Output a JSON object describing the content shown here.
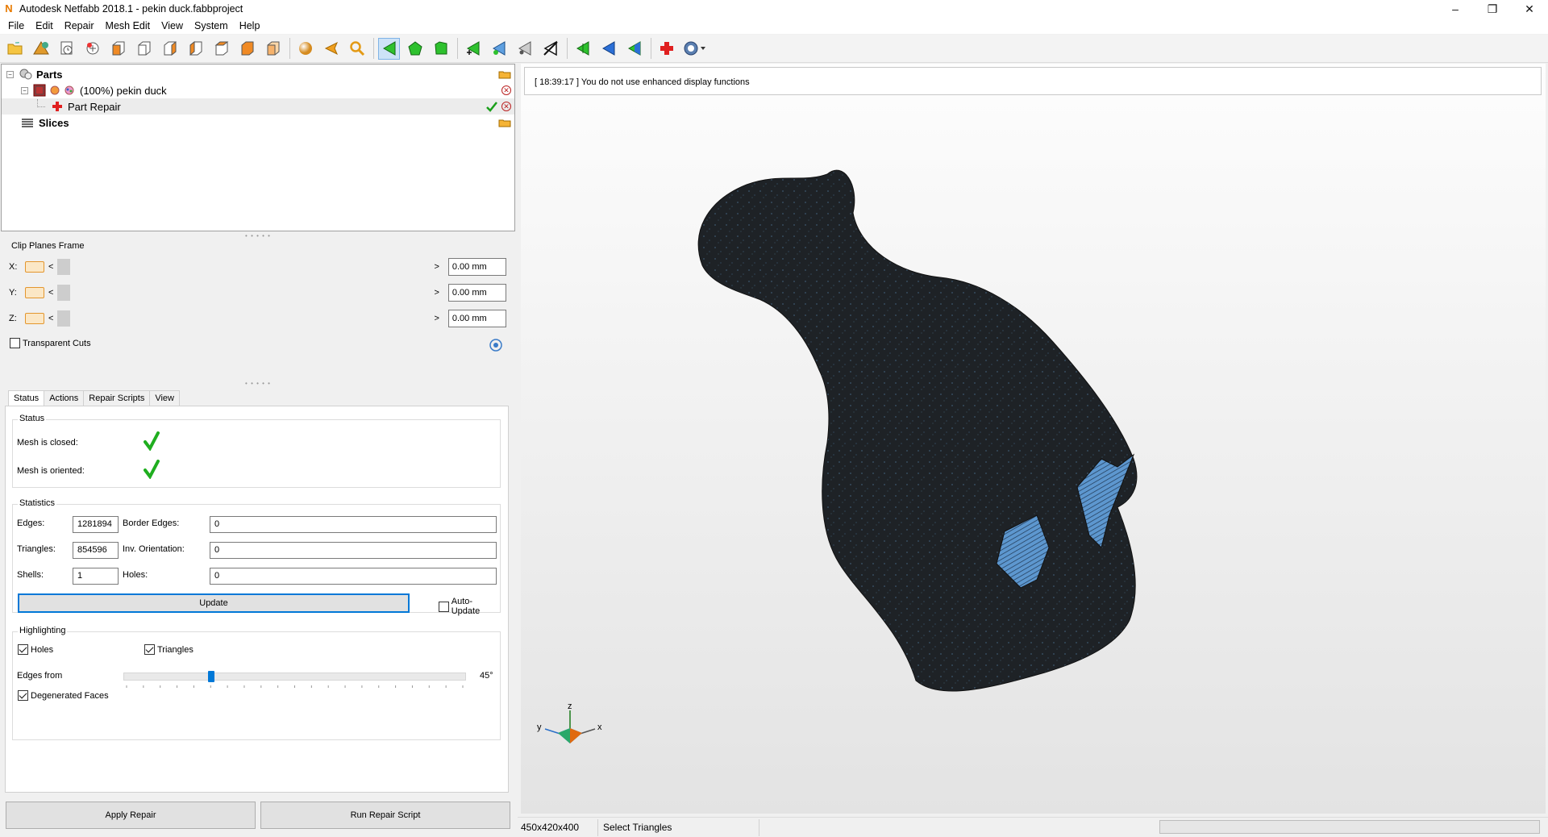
{
  "window": {
    "title": "Autodesk Netfabb 2018.1 - pekin duck.fabbproject",
    "app_icon": "N",
    "minimize": "–",
    "maximize": "❐",
    "close": "✕"
  },
  "menu": [
    "File",
    "Edit",
    "Repair",
    "Mesh Edit",
    "View",
    "System",
    "Help"
  ],
  "toolbar_icons": [
    "open-folder-icon",
    "add-part-icon",
    "save-icon",
    "new-project-icon",
    "view-front-icon",
    "view-back-icon",
    "view-left-icon",
    "view-right-icon",
    "view-top-icon",
    "view-bottom-icon",
    "view-iso-icon",
    "sphere-icon",
    "arrow-left-icon",
    "zoom-icon",
    "select-triangle-icon",
    "select-surface-icon",
    "select-shell-icon",
    "add-triangle-icon",
    "remove-triangle-icon",
    "move-point-icon",
    "cut-icon",
    "triangle-green-icon",
    "triangle-blue-icon",
    "triangle-mixed-icon",
    "repair-cross-icon",
    "help-dropdown-icon"
  ],
  "tree": {
    "parts_label": "Parts",
    "part_label": "(100%) pekin duck",
    "repair_label": "Part Repair",
    "slices_label": "Slices"
  },
  "clip": {
    "title": "Clip Planes Frame",
    "axes": [
      {
        "axis": "X:",
        "value": "0.00 mm"
      },
      {
        "axis": "Y:",
        "value": "0.00 mm"
      },
      {
        "axis": "Z:",
        "value": "0.00 mm"
      }
    ],
    "transparent_label": "Transparent Cuts",
    "left_arrow": "<",
    "right_arrow": ">"
  },
  "tabs": [
    "Status",
    "Actions",
    "Repair Scripts",
    "View"
  ],
  "status": {
    "group_title": "Status",
    "closed_label": "Mesh is closed:",
    "oriented_label": "Mesh is oriented:"
  },
  "stats": {
    "group_title": "Statistics",
    "edges_label": "Edges:",
    "edges_value": "1281894",
    "border_edges_label": "Border Edges:",
    "border_edges_value": "0",
    "triangles_label": "Triangles:",
    "triangles_value": "854596",
    "inv_orientation_label": "Inv. Orientation:",
    "inv_orientation_value": "0",
    "shells_label": "Shells:",
    "shells_value": "1",
    "holes_label": "Holes:",
    "holes_value": "0",
    "update_label": "Update",
    "auto_update_label": "Auto-Update"
  },
  "highlighting": {
    "group_title": "Highlighting",
    "holes_label": "Holes",
    "triangles_label": "Triangles",
    "edges_from_label": "Edges from",
    "edges_from_value": "45°",
    "edges_from_level": 0.25,
    "degenerated_label": "Degenerated Faces"
  },
  "buttons": {
    "apply_repair": "Apply Repair",
    "run_script": "Run Repair Script"
  },
  "viewport": {
    "message": "[ 18:39:17 ] You do not use enhanced display functions",
    "axis_z": "z",
    "axis_x": "x",
    "axis_y": "y"
  },
  "statusbar": {
    "dimensions": "450x420x400",
    "mode": "Select Triangles"
  }
}
